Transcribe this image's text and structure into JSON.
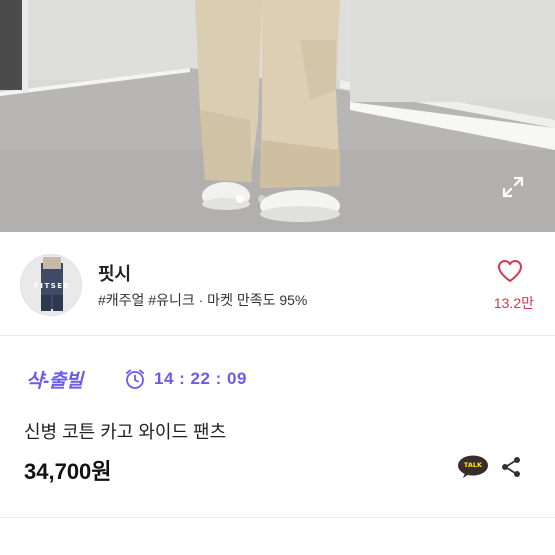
{
  "seller": {
    "name": "핏시",
    "tags": "#캐주얼 #유니크 · 마켓 만족도 95%",
    "avatar_text": "FITSEE",
    "likes": "13.2만"
  },
  "product": {
    "promo_badge": "샥-출빌",
    "countdown": "14 : 22 : 09",
    "title": "신병 코튼 카고 와이드 팬츠",
    "price": "34,700원"
  },
  "actions": {
    "talk_label": "TALK"
  },
  "gallery": {
    "current_index": 1,
    "total": 2
  },
  "colors": {
    "accent": "#6b5bef",
    "like": "#d9384e",
    "kakao": "#3a2e2c",
    "kakao_text": "#ffe812"
  },
  "icons": [
    "expand-icon",
    "heart-icon",
    "alarm-clock-icon",
    "kakao-talk-icon",
    "share-icon"
  ]
}
